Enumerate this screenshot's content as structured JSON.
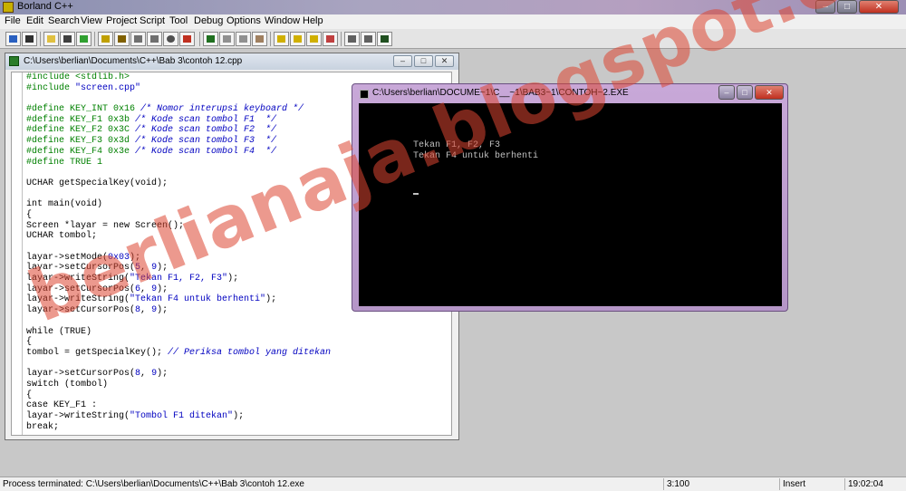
{
  "app": {
    "title": "Borland C++",
    "min": "–",
    "max": "□",
    "close": "✕"
  },
  "menu": [
    "File",
    "Edit",
    "Search",
    "View",
    "Project",
    "Script",
    "Tool",
    "Debug",
    "Options",
    "Window",
    "Help"
  ],
  "toolbar": {
    "buttons": [
      "open-project-icon",
      "save-icon",
      "open-file-icon",
      "print-icon",
      "run-icon",
      "compile-icon",
      "make-icon",
      "step-over-icon",
      "trace-into-icon",
      "stop-icon",
      "breakpoint-icon",
      "undo-icon",
      "cut-icon",
      "copy-icon",
      "paste-icon",
      "find-icon",
      "replace-icon",
      "search-again-icon",
      "browse-icon",
      "window-tile-icon",
      "help-icon"
    ]
  },
  "editor": {
    "title": "C:\\Users\\berlian\\Documents\\C++\\Bab 3\\contoh 12.cpp",
    "min": "–",
    "max": "□",
    "close": "✕",
    "lines": [
      [
        [
          "pp",
          "#include <stdlib.h>"
        ]
      ],
      [
        [
          "pp",
          "#include "
        ],
        [
          "str",
          "\"screen.cpp\""
        ]
      ],
      [
        [
          "kw",
          ""
        ]
      ],
      [
        [
          "pp",
          "#define KEY_INT 0x16 "
        ],
        [
          "cm",
          "/* Nomor interupsi keyboard */"
        ]
      ],
      [
        [
          "pp",
          "#define KEY_F1 0x3b "
        ],
        [
          "cm",
          "/* Kode scan tombol F1  */"
        ]
      ],
      [
        [
          "pp",
          "#define KEY_F2 0x3C "
        ],
        [
          "cm",
          "/* Kode scan tombol F2  */"
        ]
      ],
      [
        [
          "pp",
          "#define KEY_F3 0x3d "
        ],
        [
          "cm",
          "/* Kode scan tombol F3  */"
        ]
      ],
      [
        [
          "pp",
          "#define KEY_F4 0x3e "
        ],
        [
          "cm",
          "/* Kode scan tombol F4  */"
        ]
      ],
      [
        [
          "pp",
          "#define TRUE 1"
        ]
      ],
      [
        [
          "kw",
          ""
        ]
      ],
      [
        [
          "kw",
          "UCHAR getSpecialKey(void);"
        ]
      ],
      [
        [
          "kw",
          ""
        ]
      ],
      [
        [
          "kw",
          "int main(void)"
        ]
      ],
      [
        [
          "kw",
          "{"
        ]
      ],
      [
        [
          "kw",
          "Screen *layar = new Screen();"
        ]
      ],
      [
        [
          "kw",
          "UCHAR tombol;"
        ]
      ],
      [
        [
          "kw",
          ""
        ]
      ],
      [
        [
          "kw",
          "layar->setMode("
        ],
        [
          "num",
          "0x03"
        ],
        [
          "kw",
          ");"
        ]
      ],
      [
        [
          "kw",
          "layar->setCursorPos("
        ],
        [
          "num",
          "5"
        ],
        [
          "kw",
          ", "
        ],
        [
          "num",
          "9"
        ],
        [
          "kw",
          ");"
        ]
      ],
      [
        [
          "kw",
          "layar->writeString("
        ],
        [
          "str",
          "\"Tekan F1, F2, F3\""
        ],
        [
          "kw",
          ");"
        ]
      ],
      [
        [
          "kw",
          "layar->setCursorPos("
        ],
        [
          "num",
          "6"
        ],
        [
          "kw",
          ", "
        ],
        [
          "num",
          "9"
        ],
        [
          "kw",
          ");"
        ]
      ],
      [
        [
          "kw",
          "layar->writeString("
        ],
        [
          "str",
          "\"Tekan F4 untuk berhenti\""
        ],
        [
          "kw",
          ");"
        ]
      ],
      [
        [
          "kw",
          "layar->setCursorPos("
        ],
        [
          "num",
          "8"
        ],
        [
          "kw",
          ", "
        ],
        [
          "num",
          "9"
        ],
        [
          "kw",
          ");"
        ]
      ],
      [
        [
          "kw",
          ""
        ]
      ],
      [
        [
          "kw",
          "while (TRUE)"
        ]
      ],
      [
        [
          "kw",
          "{"
        ]
      ],
      [
        [
          "kw",
          "tombol = getSpecialKey(); "
        ],
        [
          "cm",
          "// Periksa tombol yang ditekan"
        ]
      ],
      [
        [
          "kw",
          ""
        ]
      ],
      [
        [
          "kw",
          "layar->setCursorPos("
        ],
        [
          "num",
          "8"
        ],
        [
          "kw",
          ", "
        ],
        [
          "num",
          "9"
        ],
        [
          "kw",
          ");"
        ]
      ],
      [
        [
          "kw",
          "switch (tombol)"
        ]
      ],
      [
        [
          "kw",
          "{"
        ]
      ],
      [
        [
          "kw",
          "case KEY_F1 :"
        ]
      ],
      [
        [
          "kw",
          "layar->writeString("
        ],
        [
          "str",
          "\"Tombol F1 ditekan\""
        ],
        [
          "kw",
          ");"
        ]
      ],
      [
        [
          "kw",
          "break;"
        ]
      ]
    ]
  },
  "console": {
    "title": "C:\\Users\\berlian\\DOCUME~1\\C__~1\\BAB3~1\\CONTOH~2.EXE",
    "min": "–",
    "max": "□",
    "close": "✕",
    "lines": [
      "Tekan F1, F2, F3",
      "Tekan F4 untuk berhenti"
    ]
  },
  "watermark": "berlianaja.blogspot.com",
  "status": {
    "message": "Process terminated: C:\\Users\\berlian\\Documents\\C++\\Bab 3\\contoh 12.exe",
    "position": "3:100",
    "mode": "Insert",
    "time": "19:02:04"
  },
  "colors": {
    "preprocessor": "#008000",
    "string": "#0000c0",
    "comment": "#0000c0",
    "watermark": "#dc4632",
    "console_bg": "#000000",
    "console_text": "#c0c0c0"
  }
}
